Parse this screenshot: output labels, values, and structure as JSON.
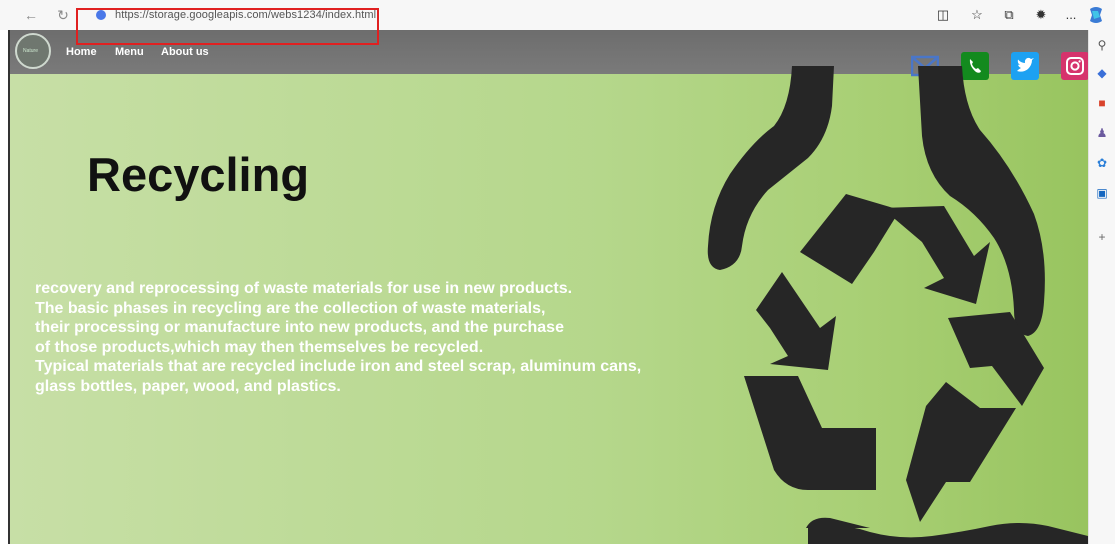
{
  "browser": {
    "url": "https://storage.googleapis.com/webs1234/index.html",
    "back_icon": "back-arrow-icon",
    "reload_icon": "reload-icon",
    "more_label": "..."
  },
  "site": {
    "logo_text": "Nature",
    "nav": [
      "Home",
      "Menu",
      "About us"
    ],
    "social": [
      "email-icon",
      "phone-icon",
      "twitter-icon",
      "instagram-icon"
    ],
    "colors": {
      "email": "#4a76c8",
      "phone": "#138a1e",
      "twitter": "#1da1f2",
      "instagram": "#d6336c"
    }
  },
  "hero": {
    "title": "Recycling",
    "lines": [
      "recovery and reprocessing of waste materials for use in new products.",
      "The basic phases in recycling are the collection of waste materials,",
      "their processing or manufacture into new products, and the purchase",
      "of those products,which may then themselves be recycled.",
      "Typical materials that are recycled include iron and steel scrap, aluminum cans,",
      "glass bottles, paper, wood, and plastics."
    ]
  }
}
